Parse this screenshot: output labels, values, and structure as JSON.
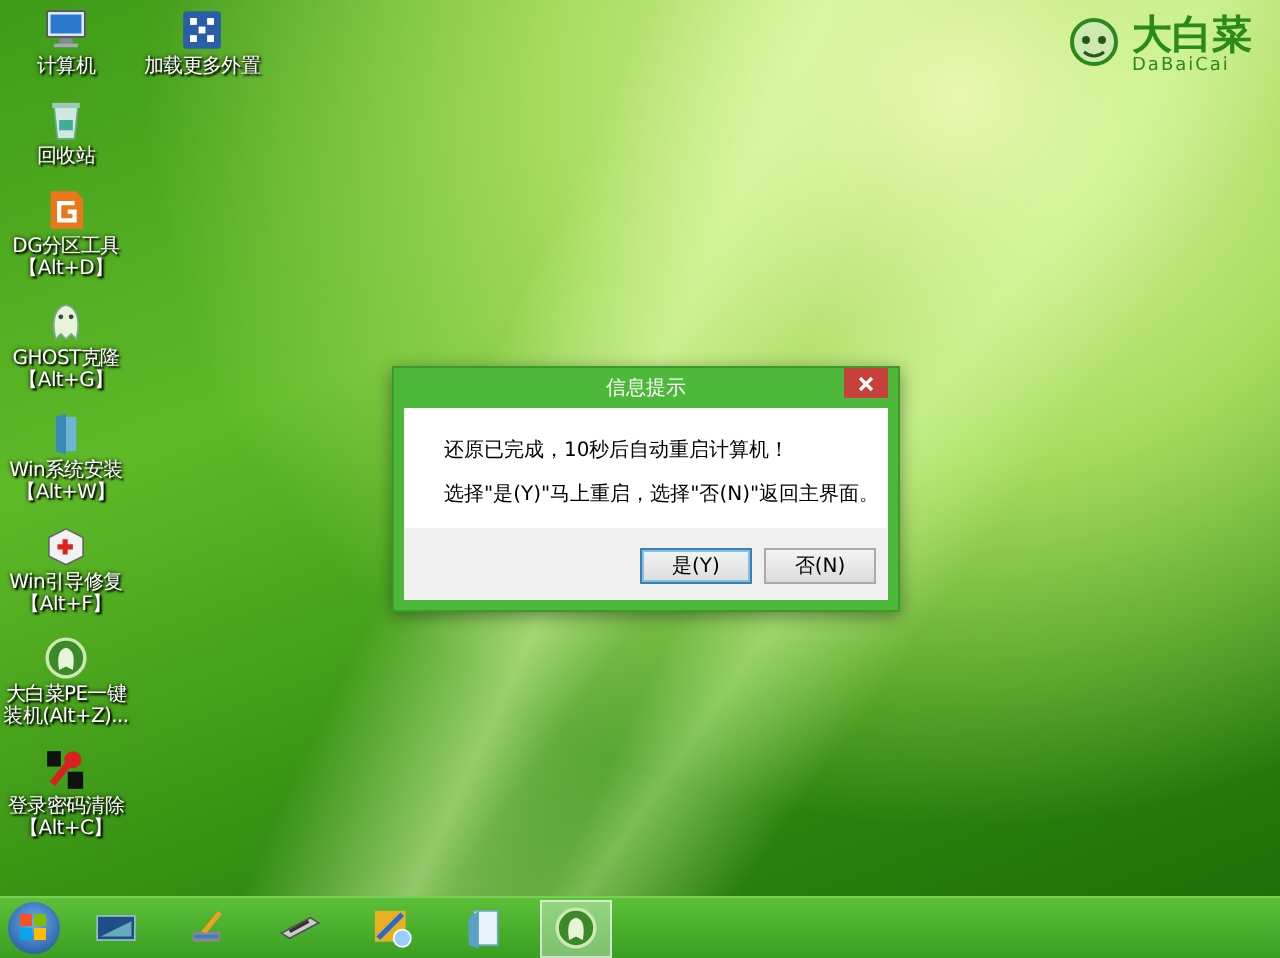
{
  "desktop_icons": [
    {
      "kind": "computer",
      "label_lines": [
        "计算机"
      ]
    },
    {
      "kind": "trash",
      "label_lines": [
        "回收站"
      ]
    },
    {
      "kind": "partition",
      "label_lines": [
        "DG分区工具",
        "【Alt+D】"
      ]
    },
    {
      "kind": "ghost",
      "label_lines": [
        "GHOST克隆",
        "【Alt+G】"
      ]
    },
    {
      "kind": "installer",
      "label_lines": [
        "Win系统安装",
        "【Alt+W】"
      ]
    },
    {
      "kind": "repair",
      "label_lines": [
        "Win引导修复",
        "【Alt+F】"
      ]
    },
    {
      "kind": "pe",
      "label_lines": [
        "大白菜PE一键",
        "装机(Alt+Z)..."
      ]
    },
    {
      "kind": "password",
      "label_lines": [
        "登录密码清除",
        "【Alt+C】"
      ]
    }
  ],
  "desktop_icons_column_2": [
    {
      "kind": "mount",
      "label_lines": [
        "加载更多外置"
      ]
    }
  ],
  "logo": {
    "name": "大白菜",
    "subtitle": "DaBaiCai"
  },
  "dialog": {
    "title": "信息提示",
    "lines": [
      "还原已完成，10秒后自动重启计算机！",
      "选择\"是(Y)\"马上重启，选择\"否(N)\"返回主界面。"
    ],
    "buttons": [
      {
        "label": "是(Y)",
        "selected": true
      },
      {
        "label": "否(N)",
        "selected": false
      }
    ]
  },
  "taskbar": {
    "items": [
      {
        "kind": "screen",
        "selected": false
      },
      {
        "kind": "brush",
        "selected": false
      },
      {
        "kind": "chip",
        "selected": false
      },
      {
        "kind": "tools",
        "selected": false
      },
      {
        "kind": "notepad",
        "selected": false
      },
      {
        "kind": "pe",
        "selected": true
      }
    ]
  }
}
